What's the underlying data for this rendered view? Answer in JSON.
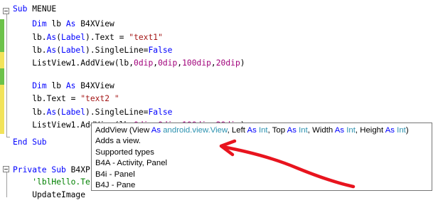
{
  "editor": {
    "lines": [
      {
        "id": "l1",
        "parts": [
          [
            "kw",
            "Sub "
          ],
          [
            "t",
            "MENUE"
          ]
        ]
      },
      {
        "id": "l2",
        "parts": [
          [
            "t",
            "    "
          ],
          [
            "kw",
            "Dim "
          ],
          [
            "t",
            "lb "
          ],
          [
            "kw",
            "As "
          ],
          [
            "t",
            "B4XView"
          ]
        ]
      },
      {
        "id": "l3",
        "parts": [
          [
            "t",
            "    lb."
          ],
          [
            "kw",
            "As"
          ],
          [
            "t",
            "("
          ],
          [
            "kw",
            "Label"
          ],
          [
            "t",
            ").Text = "
          ],
          [
            "str",
            "\"text1\""
          ]
        ]
      },
      {
        "id": "l4",
        "parts": [
          [
            "t",
            "    lb."
          ],
          [
            "kw",
            "As"
          ],
          [
            "t",
            "("
          ],
          [
            "kw",
            "Label"
          ],
          [
            "t",
            ").SingleLine="
          ],
          [
            "kw",
            "False"
          ]
        ]
      },
      {
        "id": "l5",
        "parts": [
          [
            "t",
            "    ListView1.AddView(lb,"
          ],
          [
            "num",
            "0dip"
          ],
          [
            "t",
            ","
          ],
          [
            "num",
            "0dip"
          ],
          [
            "t",
            ","
          ],
          [
            "num",
            "100dip"
          ],
          [
            "t",
            ","
          ],
          [
            "num",
            "20dip"
          ],
          [
            "t",
            ")"
          ]
        ]
      },
      {
        "id": "l6",
        "parts": [
          [
            "t",
            ""
          ]
        ]
      },
      {
        "id": "l7",
        "parts": [
          [
            "t",
            "    "
          ],
          [
            "kw",
            "Dim "
          ],
          [
            "t",
            "lb "
          ],
          [
            "kw",
            "As "
          ],
          [
            "t",
            "B4XView"
          ]
        ]
      },
      {
        "id": "l8",
        "parts": [
          [
            "t",
            "    lb.Text = "
          ],
          [
            "str",
            "\"text2 \""
          ]
        ]
      },
      {
        "id": "l9",
        "parts": [
          [
            "t",
            "    lb."
          ],
          [
            "kw",
            "As"
          ],
          [
            "t",
            "("
          ],
          [
            "kw",
            "Label"
          ],
          [
            "t",
            ").SingleLine="
          ],
          [
            "kw",
            "False"
          ]
        ]
      },
      {
        "id": "l10",
        "parts": [
          [
            "t",
            "    ListView1.AddView(lb,"
          ],
          [
            "num",
            "0dip"
          ],
          [
            "t",
            ","
          ],
          [
            "num",
            "0dip"
          ],
          [
            "t",
            ","
          ],
          [
            "num",
            "100dip"
          ],
          [
            "t",
            ","
          ],
          [
            "num",
            "20dip"
          ],
          [
            "t",
            ")"
          ]
        ]
      },
      {
        "id": "l11",
        "parts": [
          [
            "t",
            ""
          ]
        ]
      },
      {
        "id": "l12",
        "parts": [
          [
            "kw",
            "End Sub"
          ]
        ]
      },
      {
        "id": "l13",
        "parts": [
          [
            "t",
            ""
          ]
        ]
      },
      {
        "id": "l14",
        "parts": [
          [
            "kw",
            "Private Sub "
          ],
          [
            "t",
            "B4XP"
          ]
        ]
      },
      {
        "id": "l15",
        "parts": [
          [
            "t",
            "    "
          ],
          [
            "cmt",
            "'lblHello.Te"
          ]
        ]
      },
      {
        "id": "l16",
        "parts": [
          [
            "t",
            "    UpdateImage"
          ]
        ]
      }
    ]
  },
  "tooltip": {
    "signature": {
      "method": "AddView",
      "open": " (View ",
      "as1": "As ",
      "type1": "android.",
      "type1b": "view",
      "type1c": ".View",
      "p2": ", Left ",
      "as2": "As ",
      "type2": "Int",
      "p3": ", Top ",
      "as3": "As ",
      "type3": "Int",
      "p4": ", Width ",
      "as4": "As ",
      "type4": "Int",
      "p5": ", Height ",
      "as5": "As ",
      "type5": "Int",
      "close": ")"
    },
    "description": "Adds a view.",
    "supported_label": "Supported types",
    "supported": [
      "B4A - Activity, Panel",
      "B4i - Panel",
      "B4J - Pane"
    ]
  },
  "colors": {
    "keyword": "#0000ff",
    "string": "#a31515",
    "number": "#a0007a",
    "comment": "#008000",
    "gutter_saved": "#6cc24a",
    "gutter_changed": "#f2e35a",
    "annotation": "#e8141e"
  }
}
